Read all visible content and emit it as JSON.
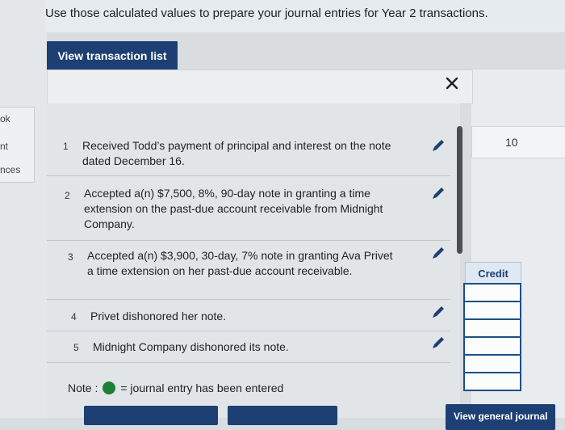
{
  "sidebar": {
    "items": [
      "ok",
      "nt",
      "nces"
    ]
  },
  "instruction": "Use those calculated values to prepare your journal entries for Year 2 transactions.",
  "view_button_label": "View transaction list",
  "close_icon": "close-icon",
  "transactions": [
    {
      "num": "1",
      "text": "Received Todd’s payment of principal and interest on the note dated December 16."
    },
    {
      "num": "2",
      "text": "Accepted a(n) $7,500, 8%, 90-day note in granting a time extension on the past-due account receivable from Midnight Company."
    },
    {
      "num": "3",
      "text": "Accepted a(n) $3,900, 30-day, 7% note in granting Ava Privet a time extension on her past-due account receivable."
    },
    {
      "num": "4",
      "text": "Privet dishonored her note."
    },
    {
      "num": "5",
      "text": "Midnight Company dishonored its note."
    }
  ],
  "right_panel": {
    "number": "10",
    "credit_header": "Credit"
  },
  "note": {
    "label": "Note :",
    "text": "= journal entry has been entered"
  },
  "bottom": {
    "view_general_journal": "View general journal"
  },
  "colors": {
    "primary": "#1d3f73",
    "entered_dot": "#1e7f36"
  }
}
